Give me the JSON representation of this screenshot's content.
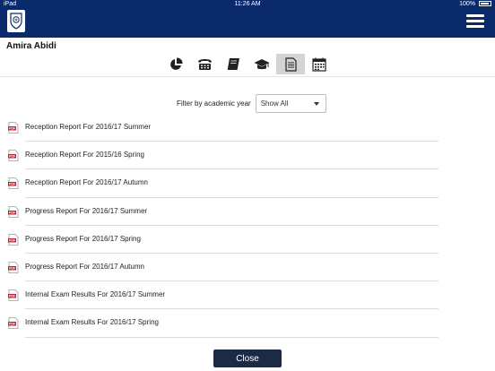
{
  "status_bar": {
    "carrier": "iPad",
    "time": "11:26 AM",
    "battery": "100%"
  },
  "header": {
    "student_name": "Amira Abidi"
  },
  "tabs": [
    {
      "icon": "pie-chart-icon"
    },
    {
      "icon": "telephone-icon"
    },
    {
      "icon": "book-icon"
    },
    {
      "icon": "graduation-cap-icon"
    },
    {
      "icon": "document-icon",
      "active": true
    },
    {
      "icon": "calendar-icon"
    }
  ],
  "filter": {
    "label": "Filter by academic year",
    "selected": "Show All"
  },
  "reports": [
    "Reception Report For 2016/17 Summer",
    "Reception Report For 2015/16 Spring",
    "Reception Report For 2016/17 Autumn",
    "Progress Report For 2016/17 Summer",
    "Progress Report For 2016/17 Spring",
    "Progress Report For 2016/17 Autumn",
    "Internal Exam Results For 2016/17 Summer",
    "Internal Exam Results For 2016/17 Spring"
  ],
  "footer": {
    "close_label": "Close"
  },
  "colors": {
    "header_bg": "#0a2a6b",
    "button_bg": "#1b2b46",
    "pdf_red": "#c8202a"
  }
}
